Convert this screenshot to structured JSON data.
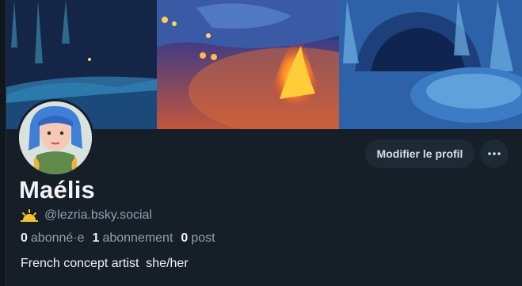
{
  "profile": {
    "display_name": "Maélis",
    "handle": "@lezria.bsky.social",
    "handle_emoji": "🌤",
    "bio": "French concept artist  she/her"
  },
  "stats": {
    "followers_count": "0",
    "followers_label": "abonné·e",
    "following_count": "1",
    "following_label": "abonnement",
    "posts_count": "0",
    "posts_label": "post"
  },
  "actions": {
    "edit_profile_label": "Modifier le profil",
    "more_icon": "ellipsis-icon"
  },
  "colors": {
    "background": "#161e27",
    "button_bg": "#1e2936",
    "muted_text": "#8fa0b3",
    "primary_text": "#f1f3f5"
  }
}
